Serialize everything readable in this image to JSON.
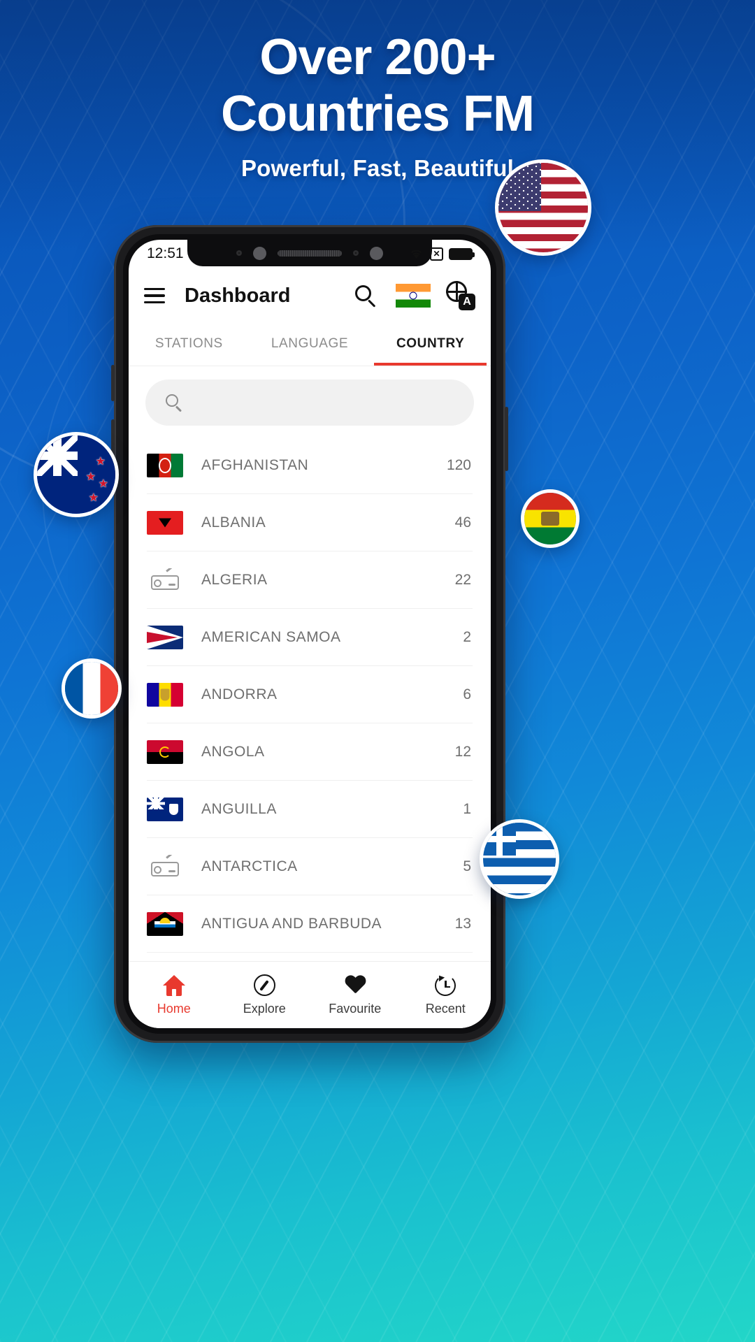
{
  "promo": {
    "headline_line1": "Over 200+",
    "headline_line2": "Countries FM",
    "subheadline": "Powerful, Fast, Beautiful"
  },
  "floating_flags": [
    {
      "name": "united-states",
      "label": "United States"
    },
    {
      "name": "new-zealand",
      "label": "New Zealand"
    },
    {
      "name": "bolivia",
      "label": "Bolivia"
    },
    {
      "name": "france",
      "label": "France"
    },
    {
      "name": "greece",
      "label": "Greece"
    }
  ],
  "phone": {
    "statusbar": {
      "time": "12:51",
      "wifi_icon": "wifi-icon",
      "signal_icon": "signal-off-icon",
      "battery_icon": "battery-full-icon"
    },
    "appbar": {
      "menu_icon": "hamburger-menu-icon",
      "title": "Dashboard",
      "search_icon": "search-icon",
      "flag_icon": "india-flag-icon",
      "translate_icon": "translate-icon",
      "translate_badge": "A"
    },
    "tabs": [
      {
        "label": "STATIONS",
        "active": false
      },
      {
        "label": "LANGUAGE",
        "active": false
      },
      {
        "label": "COUNTRY",
        "active": true
      }
    ],
    "search": {
      "icon": "search-icon",
      "value": "",
      "placeholder": ""
    },
    "countries": [
      {
        "flag": "afghanistan",
        "name": "AFGHANISTAN",
        "count": "120"
      },
      {
        "flag": "albania",
        "name": "ALBANIA",
        "count": "46"
      },
      {
        "flag": "radio-placeholder",
        "name": "ALGERIA",
        "count": "22"
      },
      {
        "flag": "american-samoa",
        "name": "AMERICAN SAMOA",
        "count": "2"
      },
      {
        "flag": "andorra",
        "name": "ANDORRA",
        "count": "6"
      },
      {
        "flag": "angola",
        "name": "ANGOLA",
        "count": "12"
      },
      {
        "flag": "anguilla",
        "name": "ANGUILLA",
        "count": "1"
      },
      {
        "flag": "radio-placeholder",
        "name": "ANTARCTICA",
        "count": "5"
      },
      {
        "flag": "antigua-and-barbuda",
        "name": "ANTIGUA AND BARBUDA",
        "count": "13"
      }
    ],
    "bottom_nav": [
      {
        "icon": "home-icon",
        "label": "Home",
        "active": true
      },
      {
        "icon": "compass-icon",
        "label": "Explore",
        "active": false
      },
      {
        "icon": "heart-icon",
        "label": "Favourite",
        "active": false
      },
      {
        "icon": "history-icon",
        "label": "Recent",
        "active": false
      }
    ]
  },
  "colors": {
    "accent_red": "#e8392e",
    "bg_blue": "#0d63c8",
    "bg_teal": "#22d6c8"
  }
}
